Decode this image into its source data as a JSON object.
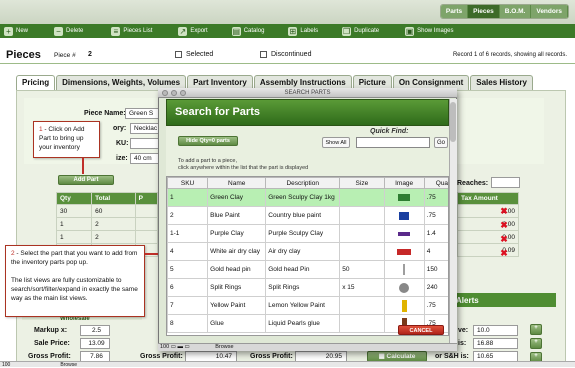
{
  "nav_tabs": [
    "Parts",
    "Pieces",
    "B.O.M.",
    "Vendors"
  ],
  "toolbar": {
    "new": "New",
    "delete": "Delete",
    "pieces_list": "Pieces List",
    "export": "Export",
    "catalog": "Catalog",
    "labels": "Labels",
    "duplicate": "Duplicate",
    "show_images": "Show Images"
  },
  "header": {
    "title": "Pieces",
    "piece_label": "Piece #",
    "piece_number": "2",
    "selected": "Selected",
    "discontinued": "Discontinued",
    "record": "Record 1 of 6 records, showing all records."
  },
  "tabs": [
    "Pricing",
    "Dimensions, Weights, Volumes",
    "Part Inventory",
    "Assembly Instructions",
    "Picture",
    "On Consignment",
    "Sales History"
  ],
  "form": {
    "piece_name_label": "Piece Name:",
    "piece_name_value": "Green S",
    "category_label": "ory:",
    "category_value": "Necklac",
    "sku_label": "KU:",
    "size_label": "ize:",
    "size_value": "40 cm",
    "add_part": "Add Part",
    "reaches": "Reaches:"
  },
  "parts_table": {
    "headers": [
      "Qty",
      "Total",
      "P"
    ],
    "rows": [
      [
        "30",
        "60"
      ],
      [
        "1",
        "2"
      ],
      [
        "1",
        "2"
      ],
      [
        "1",
        "2"
      ]
    ]
  },
  "tax_table": {
    "header": "Tax Amount",
    "rows": [
      "0.00",
      "0.00",
      "0.00",
      "0.09"
    ]
  },
  "callout1": {
    "step": "1",
    "text": " - Click on Add Part to bring up your inventory"
  },
  "callout2": {
    "step": "2",
    "text1": " - Select the part that you want to add from the inventory parts pop up.",
    "text2": "The list views are fully customizable to search/sort/filter/expand in exactly the same way as the main list views."
  },
  "dialog": {
    "window_title": "SEARCH PARTS",
    "title": "Search for Parts",
    "hide_qty": "Hide Qty=0 parts",
    "show_all": "Show All",
    "quick_find_label": "Quick Find:",
    "go": "Go",
    "instructions1": "To add a part to a piece,",
    "instructions2": "click anywhere within the list that the part is displayed",
    "columns": [
      "SKU",
      "Name",
      "Description",
      "Size",
      "Image",
      "Quanti"
    ],
    "rows": [
      {
        "sku": "1",
        "name": "Green Clay",
        "desc": "Green Sculpy Clay 1kg",
        "size": "",
        "qty": ".75",
        "color": "#2e7d32"
      },
      {
        "sku": "2",
        "name": "Blue Paint",
        "desc": "Country blue paint",
        "size": "",
        "qty": ".75",
        "color": "#1a3fa0"
      },
      {
        "sku": "1-1",
        "name": "Purple Clay",
        "desc": "Purple Sculpy Clay",
        "size": "",
        "qty": "1.4",
        "color": "#5a2a8a"
      },
      {
        "sku": "4",
        "name": "White air dry clay",
        "desc": "Air dry clay",
        "size": "",
        "qty": "4",
        "color": "#c62828"
      },
      {
        "sku": "5",
        "name": "Gold head pin",
        "desc": "Gold head Pin",
        "size": "50",
        "qty": "150",
        "color": "#9e9e9e"
      },
      {
        "sku": "6",
        "name": "Split Rings",
        "desc": "Split Rings",
        "size": "x 15",
        "qty": "240",
        "color": "#888"
      },
      {
        "sku": "7",
        "name": "Yellow Paint",
        "desc": "Lemon Yellow Paint",
        "size": "",
        "qty": ".75",
        "color": "#e0b400"
      },
      {
        "sku": "8",
        "name": "Glue",
        "desc": "Liquid Pearls glue",
        "size": "",
        "qty": ".75",
        "color": "#7b3a1a"
      }
    ],
    "cancel": "CANCEL",
    "zoom": "100",
    "browse": "Browse"
  },
  "bottom": {
    "wholesale": "Wholesale",
    "alerts": "Alerts",
    "markup_label": "Markup x:",
    "markup_value": "2.5",
    "sale_price_label": "Sale Price:",
    "sale_price_value": "13.09",
    "gross_profit_label": "Gross Profit:",
    "gross_profit_value": "7.86",
    "gp2_label": "Gross Profit:",
    "gp2_value": "10.47",
    "gp3_label": "Gross Profit:",
    "gp3_value": "20.95",
    "calculate": "Calculate",
    "ve_label": "ve:",
    "ve_value": "10.0",
    "is_label": "is:",
    "is_value": "16.88",
    "sh_label": "or S&H is:",
    "sh_value": "10.65"
  },
  "status": {
    "zoom": "100",
    "mode": "Browse"
  }
}
